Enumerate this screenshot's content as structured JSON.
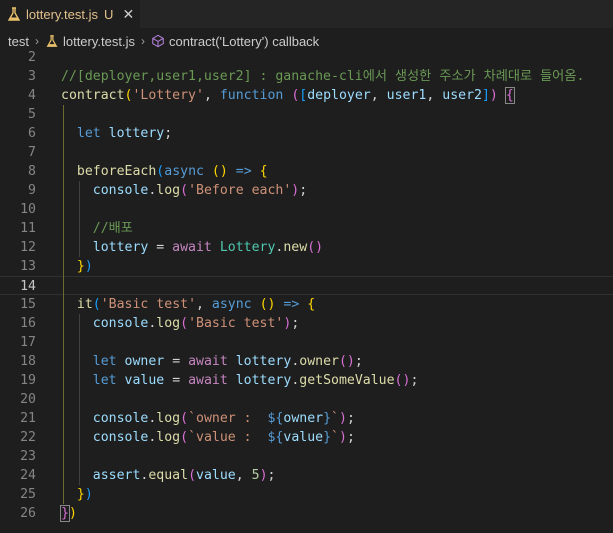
{
  "tab": {
    "filename": "lottery.test.js",
    "status": "U",
    "close_glyph": "✕",
    "icon": "js-flask-icon"
  },
  "breadcrumb": {
    "folder": "test",
    "file": "lottery.test.js",
    "symbol": "contract('Lottery') callback",
    "separator": "›"
  },
  "editor": {
    "active_line": 14,
    "lines": [
      {
        "n": "2",
        "tokens": []
      },
      {
        "n": "3",
        "tokens": [
          [
            "c-comment",
            "//[deployer,user1,user2] : ganache-cli에서 생성한 주소가 차례대로 들어옴."
          ]
        ]
      },
      {
        "n": "4",
        "tokens": [
          [
            "c-fn",
            "contract"
          ],
          [
            "c-p1",
            "("
          ],
          [
            "c-str",
            "'Lottery'"
          ],
          [
            "c-plain",
            ", "
          ],
          [
            "c-kw",
            "function"
          ],
          [
            "c-plain",
            " "
          ],
          [
            "c-p2",
            "("
          ],
          [
            "c-p3",
            "["
          ],
          [
            "c-var",
            "deployer"
          ],
          [
            "c-plain",
            ", "
          ],
          [
            "c-var",
            "user1"
          ],
          [
            "c-plain",
            ", "
          ],
          [
            "c-var",
            "user2"
          ],
          [
            "c-p3",
            "]"
          ],
          [
            "c-p2",
            ")"
          ],
          [
            "c-plain",
            " "
          ],
          [
            "c-p2 bracket-box",
            "{"
          ]
        ]
      },
      {
        "n": "5",
        "tokens": []
      },
      {
        "n": "6",
        "tokens": [
          [
            "c-plain",
            "  "
          ],
          [
            "c-kw",
            "let"
          ],
          [
            "c-plain",
            " "
          ],
          [
            "c-var",
            "lottery"
          ],
          [
            "c-plain",
            ";"
          ]
        ]
      },
      {
        "n": "7",
        "tokens": []
      },
      {
        "n": "8",
        "tokens": [
          [
            "c-plain",
            "  "
          ],
          [
            "c-fn",
            "beforeEach"
          ],
          [
            "c-p3",
            "("
          ],
          [
            "c-kw",
            "async"
          ],
          [
            "c-plain",
            " "
          ],
          [
            "c-p1",
            "()"
          ],
          [
            "c-plain",
            " "
          ],
          [
            "c-kw",
            "=>"
          ],
          [
            "c-plain",
            " "
          ],
          [
            "c-p1",
            "{"
          ]
        ]
      },
      {
        "n": "9",
        "tokens": [
          [
            "c-plain",
            "    "
          ],
          [
            "c-var",
            "console"
          ],
          [
            "c-plain",
            "."
          ],
          [
            "c-fn",
            "log"
          ],
          [
            "c-p2",
            "("
          ],
          [
            "c-str",
            "'Before each'"
          ],
          [
            "c-p2",
            ")"
          ],
          [
            "c-plain",
            ";"
          ]
        ]
      },
      {
        "n": "10",
        "tokens": []
      },
      {
        "n": "11",
        "tokens": [
          [
            "c-plain",
            "    "
          ],
          [
            "c-comment",
            "//배포"
          ]
        ]
      },
      {
        "n": "12",
        "tokens": [
          [
            "c-plain",
            "    "
          ],
          [
            "c-var",
            "lottery"
          ],
          [
            "c-plain",
            " = "
          ],
          [
            "c-ctl",
            "await"
          ],
          [
            "c-plain",
            " "
          ],
          [
            "c-cls",
            "Lottery"
          ],
          [
            "c-plain",
            "."
          ],
          [
            "c-fn",
            "new"
          ],
          [
            "c-p2",
            "()"
          ]
        ]
      },
      {
        "n": "13",
        "tokens": [
          [
            "c-plain",
            "  "
          ],
          [
            "c-p1",
            "}"
          ],
          [
            "c-p3",
            ")"
          ]
        ]
      },
      {
        "n": "14",
        "tokens": []
      },
      {
        "n": "15",
        "tokens": [
          [
            "c-plain",
            "  "
          ],
          [
            "c-fn",
            "it"
          ],
          [
            "c-p3",
            "("
          ],
          [
            "c-str",
            "'Basic test'"
          ],
          [
            "c-plain",
            ", "
          ],
          [
            "c-kw",
            "async"
          ],
          [
            "c-plain",
            " "
          ],
          [
            "c-p1",
            "()"
          ],
          [
            "c-plain",
            " "
          ],
          [
            "c-kw",
            "=>"
          ],
          [
            "c-plain",
            " "
          ],
          [
            "c-p1",
            "{"
          ]
        ]
      },
      {
        "n": "16",
        "tokens": [
          [
            "c-plain",
            "    "
          ],
          [
            "c-var",
            "console"
          ],
          [
            "c-plain",
            "."
          ],
          [
            "c-fn",
            "log"
          ],
          [
            "c-p2",
            "("
          ],
          [
            "c-str",
            "'Basic test'"
          ],
          [
            "c-p2",
            ")"
          ],
          [
            "c-plain",
            ";"
          ]
        ]
      },
      {
        "n": "17",
        "tokens": []
      },
      {
        "n": "18",
        "tokens": [
          [
            "c-plain",
            "    "
          ],
          [
            "c-kw",
            "let"
          ],
          [
            "c-plain",
            " "
          ],
          [
            "c-var",
            "owner"
          ],
          [
            "c-plain",
            " = "
          ],
          [
            "c-ctl",
            "await"
          ],
          [
            "c-plain",
            " "
          ],
          [
            "c-var",
            "lottery"
          ],
          [
            "c-plain",
            "."
          ],
          [
            "c-fn",
            "owner"
          ],
          [
            "c-p2",
            "()"
          ],
          [
            "c-plain",
            ";"
          ]
        ]
      },
      {
        "n": "19",
        "tokens": [
          [
            "c-plain",
            "    "
          ],
          [
            "c-kw",
            "let"
          ],
          [
            "c-plain",
            " "
          ],
          [
            "c-var",
            "value"
          ],
          [
            "c-plain",
            " = "
          ],
          [
            "c-ctl",
            "await"
          ],
          [
            "c-plain",
            " "
          ],
          [
            "c-var",
            "lottery"
          ],
          [
            "c-plain",
            "."
          ],
          [
            "c-fn",
            "getSomeValue"
          ],
          [
            "c-p2",
            "()"
          ],
          [
            "c-plain",
            ";"
          ]
        ]
      },
      {
        "n": "20",
        "tokens": []
      },
      {
        "n": "21",
        "tokens": [
          [
            "c-plain",
            "    "
          ],
          [
            "c-var",
            "console"
          ],
          [
            "c-plain",
            "."
          ],
          [
            "c-fn",
            "log"
          ],
          [
            "c-p2",
            "("
          ],
          [
            "c-str",
            "`owner :  "
          ],
          [
            "c-tmpl",
            "${"
          ],
          [
            "c-var",
            "owner"
          ],
          [
            "c-tmpl",
            "}"
          ],
          [
            "c-str",
            "`"
          ],
          [
            "c-p2",
            ")"
          ],
          [
            "c-plain",
            ";"
          ]
        ]
      },
      {
        "n": "22",
        "tokens": [
          [
            "c-plain",
            "    "
          ],
          [
            "c-var",
            "console"
          ],
          [
            "c-plain",
            "."
          ],
          [
            "c-fn",
            "log"
          ],
          [
            "c-p2",
            "("
          ],
          [
            "c-str",
            "`value :  "
          ],
          [
            "c-tmpl",
            "${"
          ],
          [
            "c-var",
            "value"
          ],
          [
            "c-tmpl",
            "}"
          ],
          [
            "c-str",
            "`"
          ],
          [
            "c-p2",
            ")"
          ],
          [
            "c-plain",
            ";"
          ]
        ]
      },
      {
        "n": "23",
        "tokens": []
      },
      {
        "n": "24",
        "tokens": [
          [
            "c-plain",
            "    "
          ],
          [
            "c-var",
            "assert"
          ],
          [
            "c-plain",
            "."
          ],
          [
            "c-fn",
            "equal"
          ],
          [
            "c-p2",
            "("
          ],
          [
            "c-var",
            "value"
          ],
          [
            "c-plain",
            ", "
          ],
          [
            "c-num",
            "5"
          ],
          [
            "c-p2",
            ")"
          ],
          [
            "c-plain",
            ";"
          ]
        ]
      },
      {
        "n": "25",
        "tokens": [
          [
            "c-plain",
            "  "
          ],
          [
            "c-p1",
            "}"
          ],
          [
            "c-p3",
            ")"
          ]
        ]
      },
      {
        "n": "26",
        "tokens": [
          [
            "c-p2 bracket-box",
            "}"
          ],
          [
            "c-p1",
            ")"
          ]
        ]
      }
    ]
  }
}
